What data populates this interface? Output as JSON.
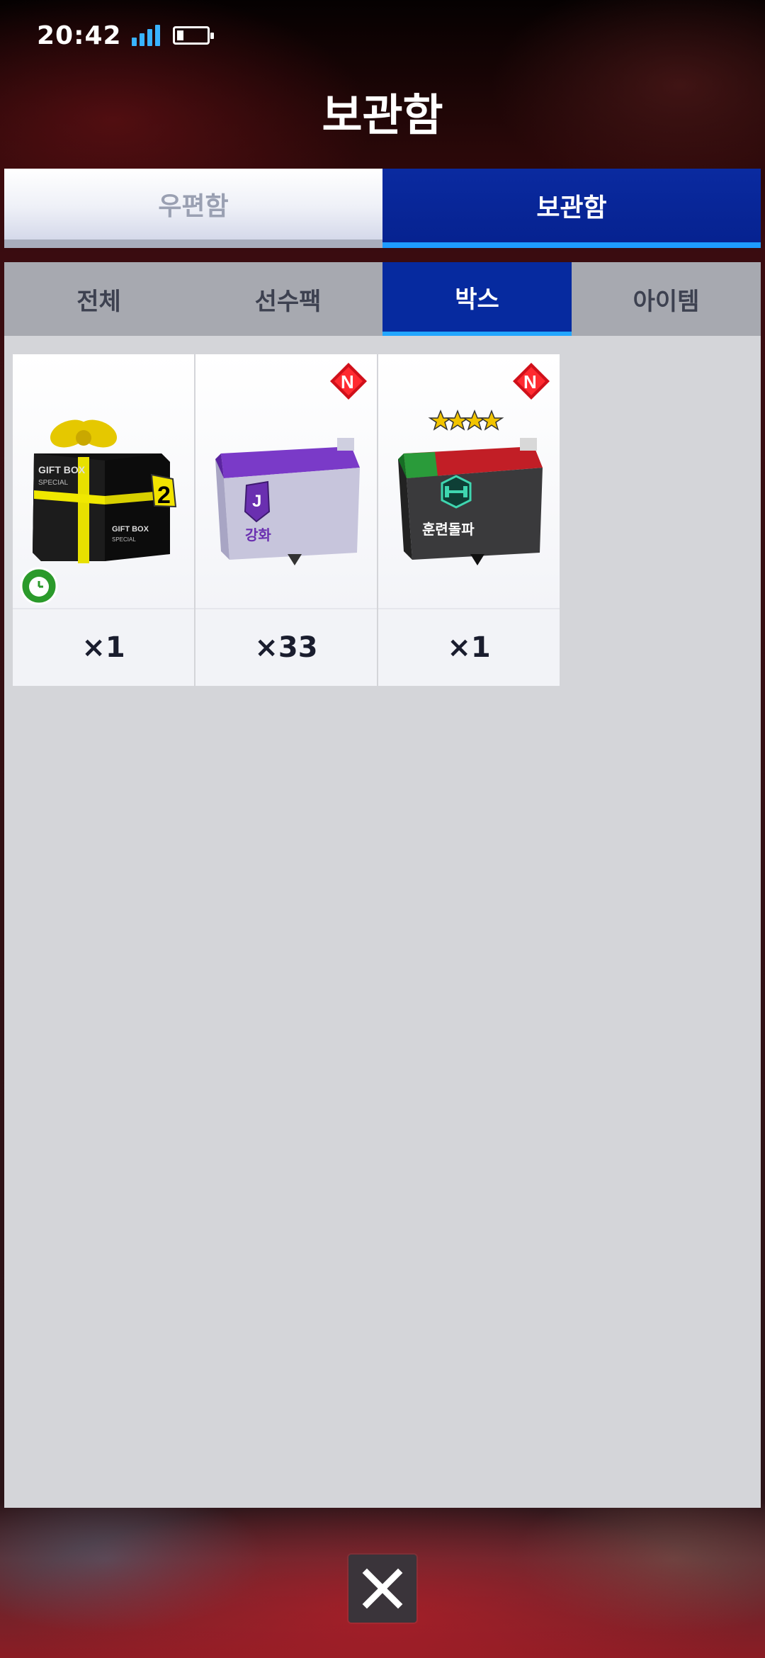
{
  "status_bar": {
    "time": "20:42"
  },
  "page_title": "보관함",
  "main_tabs": [
    {
      "label": "우편함",
      "active": false
    },
    {
      "label": "보관함",
      "active": true
    }
  ],
  "sub_tabs": [
    {
      "label": "전체",
      "active": false
    },
    {
      "label": "선수팩",
      "active": false
    },
    {
      "label": "박스",
      "active": true
    },
    {
      "label": "아이템",
      "active": false
    }
  ],
  "items": [
    {
      "name": "gift-box",
      "box_text_1": "GIFT BOX",
      "box_text_2": "SPECIAL",
      "tag_number": "2",
      "quantity": "×1",
      "icon": "clock-icon"
    },
    {
      "name": "upgrade-box",
      "box_label": "강화",
      "quantity": "×33",
      "badge": "N"
    },
    {
      "name": "training-breakthrough-box",
      "box_label": "훈련돌파",
      "stars": 4,
      "quantity": "×1",
      "badge": "N"
    }
  ],
  "close_icon": "close-icon",
  "colors": {
    "active_tab": "#062a9f",
    "active_underline": "#1e9cff",
    "panel_bg": "#d4d5d9"
  }
}
